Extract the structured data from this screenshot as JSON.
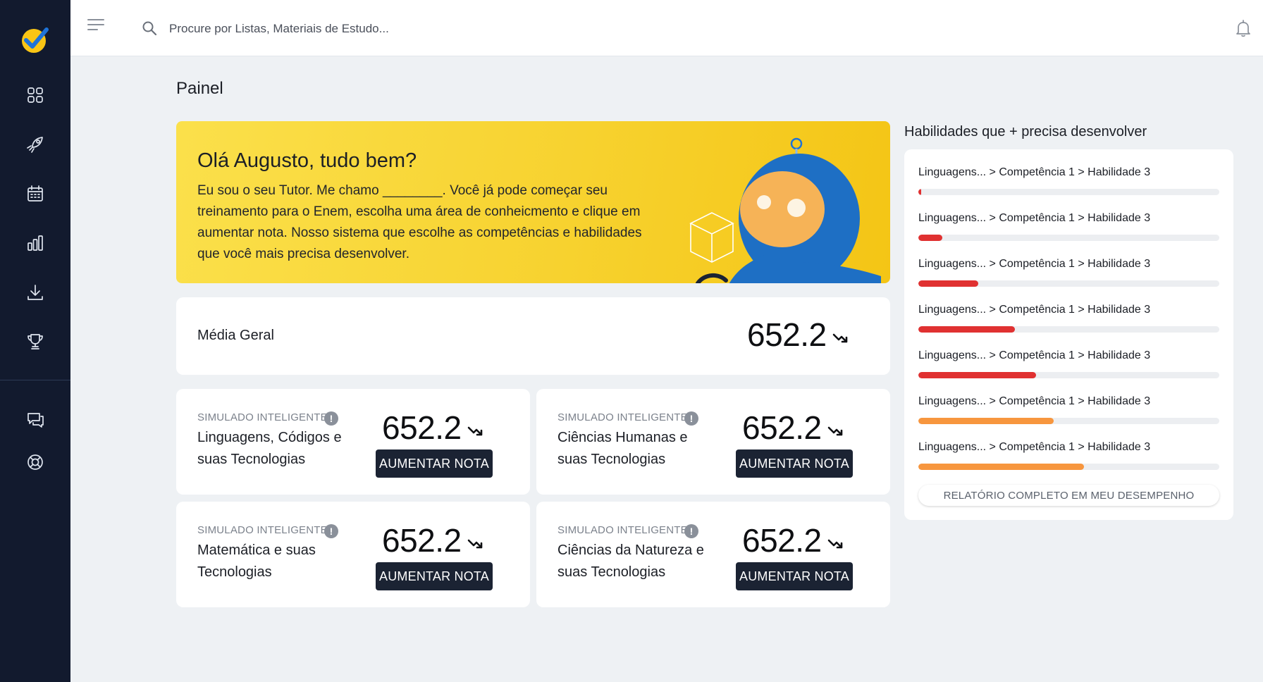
{
  "search": {
    "placeholder": "Procure por Listas, Materiais de Estudo..."
  },
  "page": {
    "title": "Painel"
  },
  "banner": {
    "title": "Olá Augusto, tudo bem?",
    "text": "Eu sou o seu Tutor. Me chamo ________. Você já pode começar seu treinamento para o Enem, escolha uma área de conheicmento e clique em aumentar nota. Nosso sistema que escolhe as competências e habilidades que você mais precisa desenvolver."
  },
  "media": {
    "label": "Média Geral",
    "score": "652.2"
  },
  "sim_cards": [
    {
      "tag": "SIMULADO INTELIGENTE",
      "name": "Linguagens, Códigos e suas Tecnologias",
      "score": "652.2",
      "button": "AUMENTAR NOTA"
    },
    {
      "tag": "SIMULADO INTELIGENTE",
      "name": "Ciências Humanas e suas Tecnologias",
      "score": "652.2",
      "button": "AUMENTAR NOTA"
    },
    {
      "tag": "SIMULADO INTELIGENTE",
      "name": "Matemática e suas Tecnologias",
      "score": "652.2",
      "button": "AUMENTAR NOTA"
    },
    {
      "tag": "SIMULADO INTELIGENTE",
      "name": "Ciências da Natureza e suas Tecnologias",
      "score": "652.2",
      "button": "AUMENTAR NOTA"
    }
  ],
  "skills": {
    "title": "Habilidades que + precisa desenvolver",
    "items": [
      {
        "label": "Linguagens... > Competência 1 > Habilidade 3",
        "progress": 0.01,
        "color": "#e03131"
      },
      {
        "label": "Linguagens... > Competência 1 > Habilidade 3",
        "progress": 0.08,
        "color": "#e03131"
      },
      {
        "label": "Linguagens... > Competência 1 > Habilidade 3",
        "progress": 0.2,
        "color": "#e03131"
      },
      {
        "label": "Linguagens... > Competência 1 > Habilidade 3",
        "progress": 0.32,
        "color": "#e03131"
      },
      {
        "label": "Linguagens... > Competência 1 > Habilidade 3",
        "progress": 0.39,
        "color": "#e03131"
      },
      {
        "label": "Linguagens... > Competência 1 > Habilidade 3",
        "progress": 0.45,
        "color": "#f7963e"
      },
      {
        "label": "Linguagens... > Competência 1 > Habilidade 3",
        "progress": 0.55,
        "color": "#f7963e"
      }
    ],
    "report_button": "RELATÓRIO COMPLETO EM MEU DESEMPENHO"
  },
  "icons": {
    "sidebar": [
      "dashboard-icon",
      "rocket-icon",
      "calendar-icon",
      "bar-chart-icon",
      "download-icon",
      "trophy-icon",
      "chat-icon",
      "lifebuoy-icon"
    ],
    "topbar": [
      "menu-icon",
      "search-icon",
      "bell-icon"
    ]
  },
  "colors": {
    "sidebar": "#121a2e",
    "banner": "#f7d22f",
    "button": "#1b2333",
    "bar_red": "#e03131",
    "bar_orange": "#f7963e"
  }
}
